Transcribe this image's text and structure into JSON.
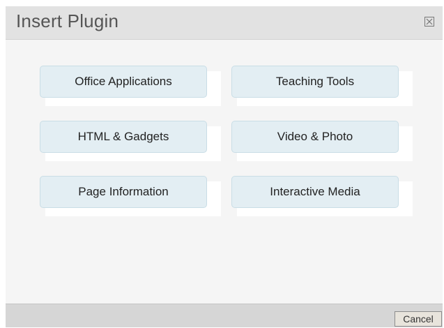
{
  "dialog": {
    "title": "Insert Plugin",
    "close_icon": "close-x-icon"
  },
  "plugins": [
    {
      "label": "Office Applications"
    },
    {
      "label": "Teaching Tools"
    },
    {
      "label": "HTML & Gadgets"
    },
    {
      "label": "Video & Photo"
    },
    {
      "label": "Page Information"
    },
    {
      "label": "Interactive Media"
    }
  ],
  "footer": {
    "cancel_label": "Cancel"
  },
  "colors": {
    "titlebar_bg": "#e2e2e2",
    "button_bg": "#e3eef3",
    "footer_bg": "#d6d6d6"
  }
}
